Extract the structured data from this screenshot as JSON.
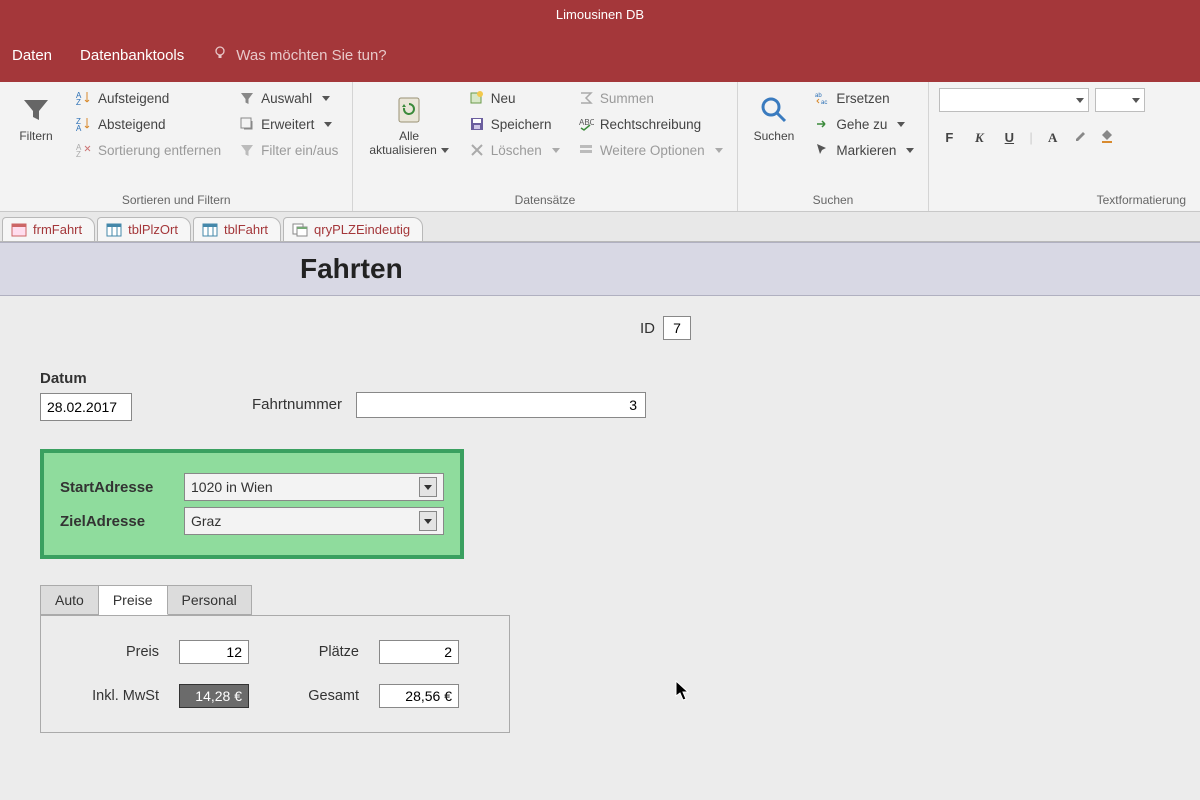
{
  "app": {
    "title": "Limousinen DB"
  },
  "menu": {
    "daten": "Daten",
    "dbtools": "Datenbanktools",
    "tellme": "Was möchten Sie tun?"
  },
  "ribbon": {
    "filter_group": {
      "filtern": "Filtern",
      "aufsteigend": "Aufsteigend",
      "absteigend": "Absteigend",
      "sort_entf": "Sortierung entfernen",
      "auswahl": "Auswahl",
      "erweitert": "Erweitert",
      "filter_toggle": "Filter ein/aus",
      "label": "Sortieren und Filtern"
    },
    "records_group": {
      "alle_akt": "Alle\naktualisieren",
      "neu": "Neu",
      "speichern": "Speichern",
      "loeschen": "Löschen",
      "summen": "Summen",
      "rechtschreibung": "Rechtschreibung",
      "weitere": "Weitere Optionen",
      "label": "Datensätze"
    },
    "find_group": {
      "suchen": "Suchen",
      "ersetzen": "Ersetzen",
      "geheZu": "Gehe zu",
      "markieren": "Markieren",
      "label": "Suchen"
    },
    "format_group": {
      "bold": "F",
      "italic": "K",
      "underline": "U",
      "font_a": "A",
      "label": "Textformatierung"
    }
  },
  "objTabs": [
    {
      "name": "frmFahrt",
      "type": "form",
      "active": false
    },
    {
      "name": "tblPlzOrt",
      "type": "table",
      "active": false
    },
    {
      "name": "tblFahrt",
      "type": "table",
      "active": false
    },
    {
      "name": "qryPLZEindeutig",
      "type": "query",
      "active": false
    }
  ],
  "form": {
    "title": "Fahrten",
    "id_label": "ID",
    "id_value": "7",
    "datum_label": "Datum",
    "datum_value": "28.02.2017",
    "fahrtnr_label": "Fahrtnummer",
    "fahrtnr_value": "3",
    "start_label": "StartAdresse",
    "start_value": "1020 in Wien",
    "ziel_label": "ZielAdresse",
    "ziel_value": "Graz",
    "subtabs": {
      "auto": "Auto",
      "preise": "Preise",
      "personal": "Personal"
    },
    "preise": {
      "preis_label": "Preis",
      "preis_value": "12",
      "plaetze_label": "Plätze",
      "plaetze_value": "2",
      "mwst_label": "Inkl. MwSt",
      "mwst_value": "14,28 €",
      "gesamt_label": "Gesamt",
      "gesamt_value": "28,56 €"
    }
  }
}
